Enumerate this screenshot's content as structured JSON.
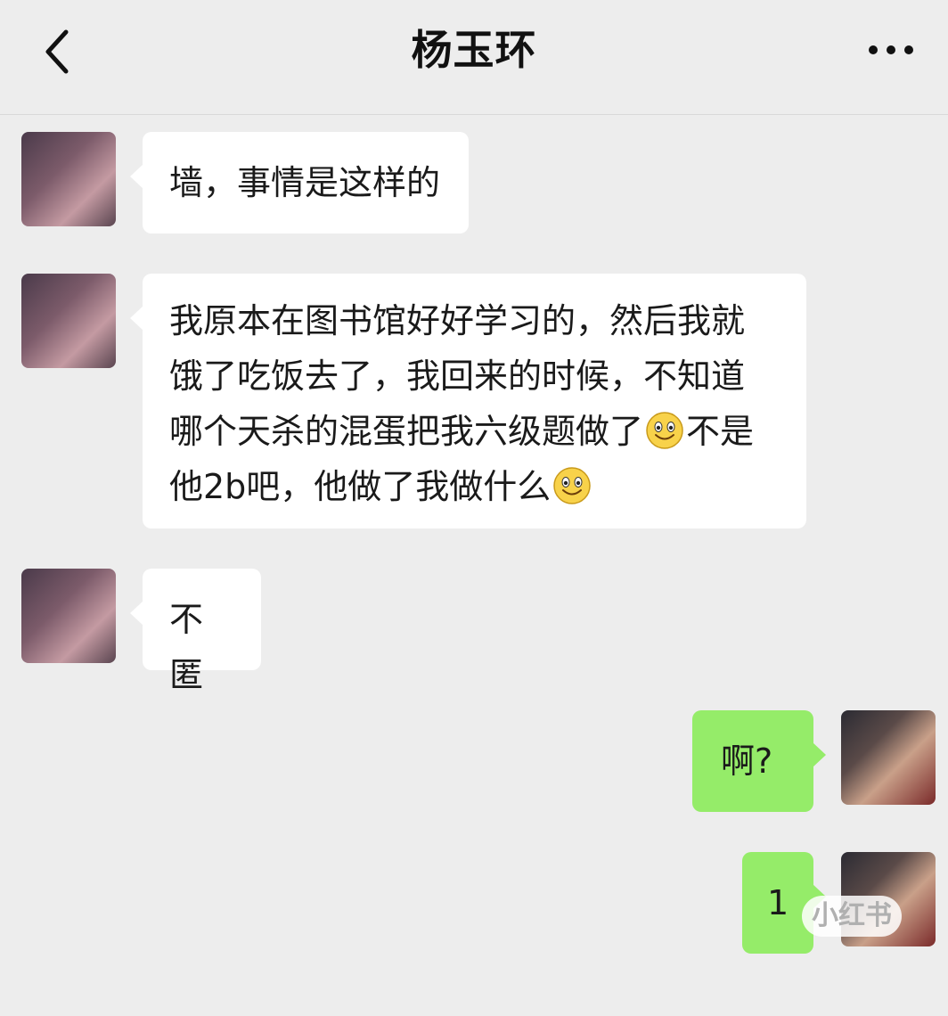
{
  "header": {
    "title": "杨玉环",
    "back_icon": "chevron-left-icon",
    "more_icon": "more-dots-icon"
  },
  "messages": [
    {
      "side": "in",
      "text": "墙，事情是这样的"
    },
    {
      "side": "in",
      "line1": "我原本在图书馆好好学习的，然后我就",
      "line2": "饿了吃饭去了，我回来的时候，不知道",
      "line3a": "哪个天杀的混蛋把我六级题做了",
      "line3b": "不是",
      "line4": "他2b吧，他做了我做什么"
    },
    {
      "side": "in",
      "text": "不匿"
    },
    {
      "side": "out",
      "text": "啊?"
    },
    {
      "side": "out",
      "text": "1"
    }
  ],
  "watermark": "小红书",
  "colors": {
    "background": "#ededed",
    "incoming": "#ffffff",
    "outgoing": "#95ec69"
  }
}
